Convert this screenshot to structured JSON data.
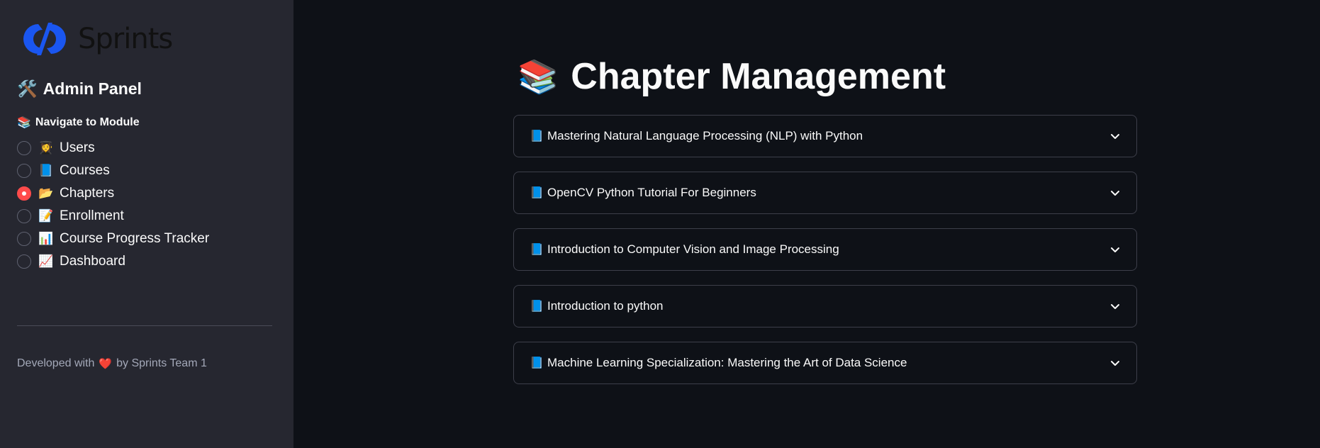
{
  "sidebar": {
    "logo_text": "Sprints",
    "panel_icon": "🛠️",
    "panel_title": "Admin Panel",
    "nav_icon": "📚",
    "nav_label": "Navigate to Module",
    "items": [
      {
        "emoji": "👩‍🎓",
        "label": "Users",
        "selected": false
      },
      {
        "emoji": "📘",
        "label": "Courses",
        "selected": false
      },
      {
        "emoji": "📂",
        "label": "Chapters",
        "selected": true
      },
      {
        "emoji": "📝",
        "label": "Enrollment",
        "selected": false
      },
      {
        "emoji": "📊",
        "label": "Course Progress Tracker",
        "selected": false
      },
      {
        "emoji": "📈",
        "label": "Dashboard",
        "selected": false
      }
    ],
    "footer": {
      "prefix": "Developed with",
      "heart": "❤️",
      "suffix": "by Sprints Team 1"
    }
  },
  "main": {
    "title_icon": "📚",
    "title": "Chapter Management",
    "expanders": [
      {
        "icon": "📘",
        "label": "Mastering Natural Language Processing (NLP) with Python"
      },
      {
        "icon": "📘",
        "label": "OpenCV Python Tutorial For Beginners"
      },
      {
        "icon": "📘",
        "label": "Introduction to Computer Vision and Image Processing"
      },
      {
        "icon": "📘",
        "label": "Introduction to python"
      },
      {
        "icon": "📘",
        "label": "Machine Learning Specialization: Mastering the Art of Data Science"
      }
    ]
  },
  "colors": {
    "sidebar_bg": "#262730",
    "main_bg": "#0e1117",
    "accent": "#ff4b4b",
    "logo_blue": "#1a56f0"
  }
}
